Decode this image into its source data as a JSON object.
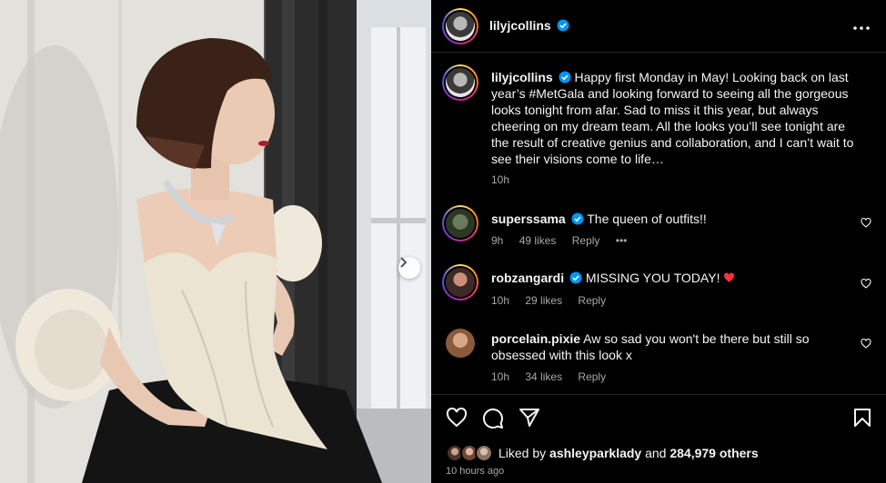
{
  "post": {
    "author": "lilyjcollins",
    "more_icon": "more-horizontal-icon",
    "next_icon": "chevron-right-icon"
  },
  "caption": {
    "username": "lilyjcollins",
    "text": "Happy first Monday in May! Looking back on last year’s #MetGala and looking forward to seeing all the gorgeous looks tonight from afar. Sad to miss it this year, but always cheering on my dream team. All the looks you’ll see tonight are the result of creative genius and collaboration, and I can’t wait to see their visions come to life…",
    "time": "10h"
  },
  "comments": [
    {
      "username": "superssama",
      "verified": true,
      "text": "The queen of outfits!!",
      "time": "9h",
      "likes": "49 likes",
      "reply": "Reply",
      "more": "•••"
    },
    {
      "username": "robzangardi",
      "verified": true,
      "text": "MISSING YOU TODAY! ",
      "time": "10h",
      "likes": "29 likes",
      "reply": "Reply"
    },
    {
      "username": "porcelain.pixie",
      "verified": false,
      "text": "Aw so sad you won't be there but still so obsessed with this look x",
      "time": "10h",
      "likes": "34 likes",
      "reply": "Reply"
    }
  ],
  "footer": {
    "liked_prefix": "Liked by ",
    "liked_user": "ashleyparklady",
    "liked_and": " and ",
    "liked_count": "284,979 others",
    "posted_ago": "10 hours ago"
  },
  "colors": {
    "verified": "#0095f6",
    "heart": "#ff3040",
    "muted": "#a8a8a8",
    "divider": "#262626"
  }
}
